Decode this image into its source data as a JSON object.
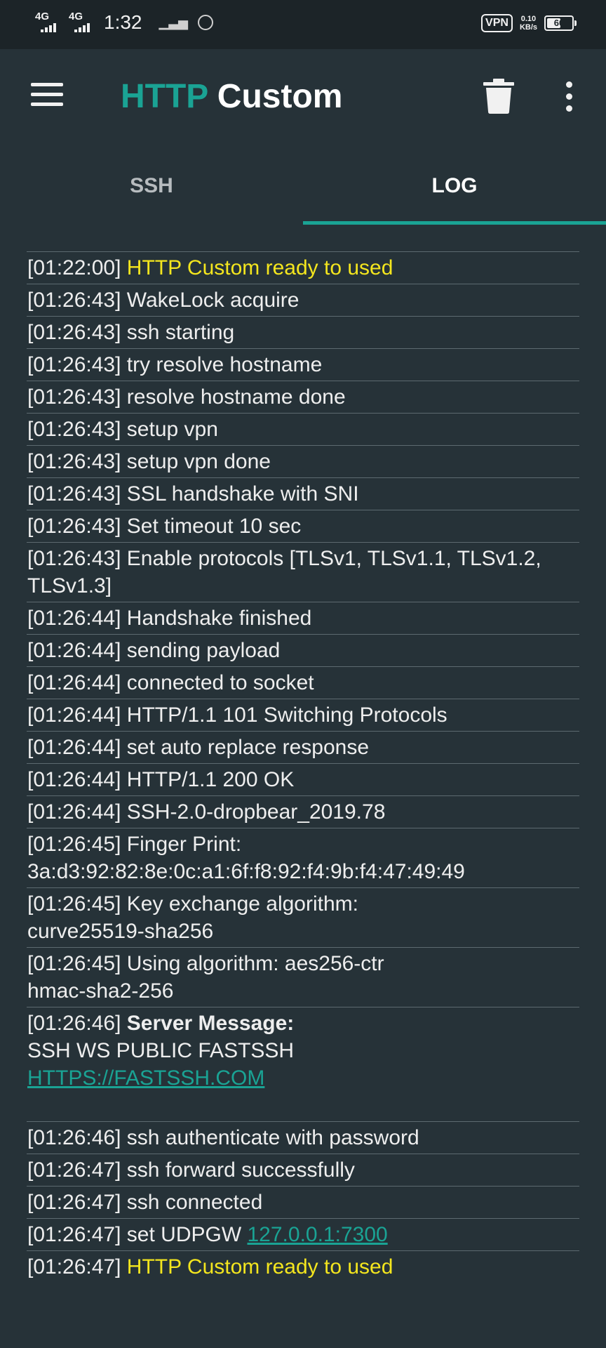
{
  "status_bar": {
    "net1": "4G",
    "net2": "4G",
    "time": "1:32",
    "vpn": "VPN",
    "speed_value": "0.10",
    "speed_unit": "KB/s",
    "battery": "60",
    "battery_level": 0.6
  },
  "app_bar": {
    "title_accent": "HTTP",
    "title_rest": " Custom",
    "accent_color": "#1aa394",
    "icons": [
      "menu-icon",
      "trash-icon",
      "more-vert-icon"
    ]
  },
  "tabs": [
    {
      "label": "SSH",
      "active": false
    },
    {
      "label": "LOG",
      "active": true
    }
  ],
  "log": [
    {
      "time": "[01:22:00]",
      "msg": "HTTP Custom ready to used",
      "highlight": true
    },
    {
      "time": "[01:26:43]",
      "msg": "WakeLock acquire"
    },
    {
      "time": "[01:26:43]",
      "msg": "ssh starting"
    },
    {
      "time": "[01:26:43]",
      "msg": "try resolve hostname"
    },
    {
      "time": "[01:26:43]",
      "msg": "resolve hostname done"
    },
    {
      "time": "[01:26:43]",
      "msg": "setup vpn"
    },
    {
      "time": "[01:26:43]",
      "msg": "setup vpn done"
    },
    {
      "time": "[01:26:43]",
      "msg": "SSL handshake with SNI"
    },
    {
      "time": "[01:26:43]",
      "msg": "Set timeout 10 sec"
    },
    {
      "time": "[01:26:43]",
      "msg": "Enable protocols [TLSv1, TLSv1.1, TLSv1.2, TLSv1.3]"
    },
    {
      "time": "[01:26:44]",
      "msg": "Handshake finished"
    },
    {
      "time": "[01:26:44]",
      "msg": "sending payload"
    },
    {
      "time": "[01:26:44]",
      "msg": "connected to socket"
    },
    {
      "time": "[01:26:44]",
      "msg": "HTTP/1.1 101 Switching Protocols"
    },
    {
      "time": "[01:26:44]",
      "msg": "set auto replace response"
    },
    {
      "time": "[01:26:44]",
      "msg": "HTTP/1.1 200 OK"
    },
    {
      "time": "[01:26:44]",
      "msg": "SSH-2.0-dropbear_2019.78"
    },
    {
      "time": "[01:26:45]",
      "msg": "Finger Print:",
      "line2": "3a:d3:92:82:8e:0c:a1:6f:f8:92:f4:9b:f4:47:49:49"
    },
    {
      "time": "[01:26:45]",
      "msg": "Key exchange algorithm:",
      "line2": "curve25519-sha256"
    },
    {
      "time": "[01:26:45]",
      "msg": "Using algorithm: aes256-ctr",
      "line2": "hmac-sha2-256"
    },
    {
      "time": "[01:26:46]",
      "bold": "Server Message:",
      "line2": "SSH WS PUBLIC FASTSSH",
      "link": "HTTPS://FASTSSH.COM",
      "blank_after": true
    },
    {
      "time": "[01:26:46]",
      "msg": "ssh authenticate with password"
    },
    {
      "time": "[01:26:47]",
      "msg": "ssh forward successfully"
    },
    {
      "time": "[01:26:47]",
      "msg": "ssh connected"
    },
    {
      "time": "[01:26:47]",
      "msg": "set UDPGW",
      "inline_link": "127.0.0.1:7300"
    },
    {
      "time": "[01:26:47]",
      "msg": "HTTP Custom ready to used",
      "highlight": true
    }
  ]
}
